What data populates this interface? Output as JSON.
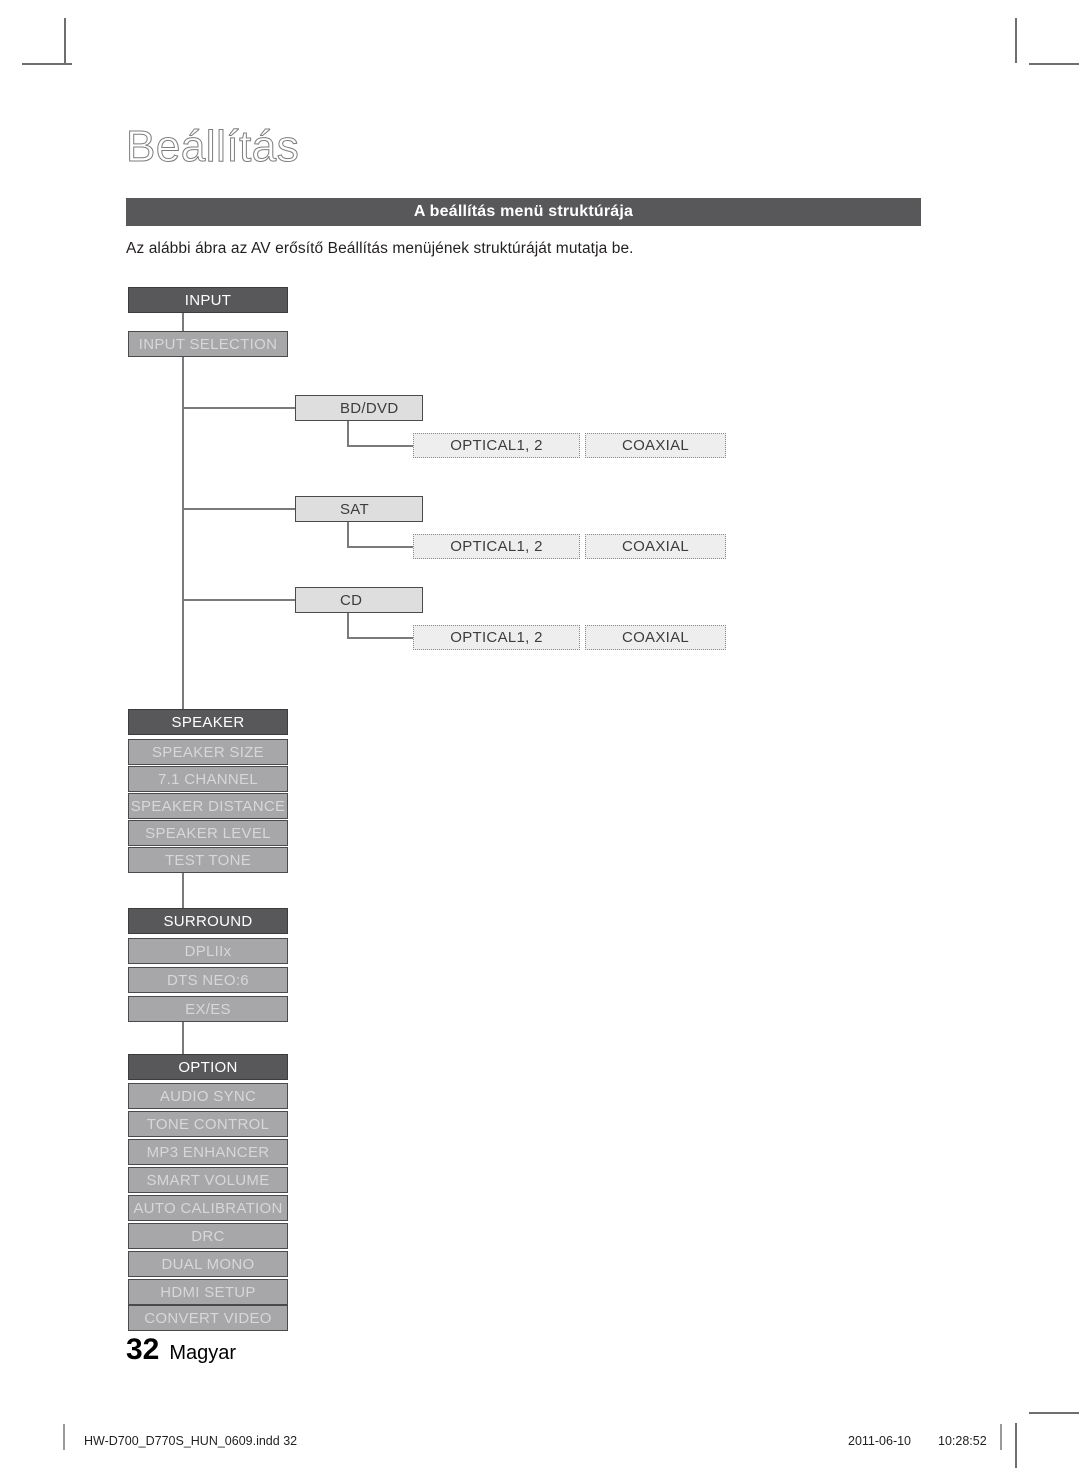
{
  "page": {
    "chapter_title": "Beállítás",
    "section_heading": "A beállítás menü struktúrája",
    "intro_text": "Az alábbi ábra az AV erősítő Beállítás menüjének struktúráját mutatja be.",
    "folio_number": "32",
    "folio_language": "Magyar",
    "imprint_file": "HW-D700_D770S_HUN_0609.indd   32",
    "imprint_date": "2011-06-10",
    "imprint_time": "10:28:52"
  },
  "colors": {
    "header_dark": "#58585b",
    "row_mid": "#a7a7a9",
    "box_light": "#dededf",
    "leaf_light": "#eeeeef",
    "line": "#7a7a7c",
    "text_dark": "#231f20"
  },
  "diagram": {
    "type": "menu-tree",
    "groups": [
      {
        "id": "input",
        "header": "INPUT",
        "rows": [
          "INPUT SELECTION"
        ],
        "sources": [
          {
            "label": "BD/DVD",
            "leaves": [
              "OPTICAL1, 2",
              "COAXIAL"
            ]
          },
          {
            "label": "SAT",
            "leaves": [
              "OPTICAL1, 2",
              "COAXIAL"
            ]
          },
          {
            "label": "CD",
            "leaves": [
              "OPTICAL1, 2",
              "COAXIAL"
            ]
          }
        ]
      },
      {
        "id": "speaker",
        "header": "SPEAKER",
        "rows": [
          "SPEAKER SIZE",
          "7.1 CHANNEL",
          "SPEAKER DISTANCE",
          "SPEAKER LEVEL",
          "TEST TONE"
        ],
        "sources": []
      },
      {
        "id": "surround",
        "header": "SURROUND",
        "rows": [
          "DPLIIx",
          "DTS NEO:6",
          "EX/ES"
        ],
        "sources": []
      },
      {
        "id": "option",
        "header": "OPTION",
        "rows": [
          "AUDIO SYNC",
          "TONE CONTROL",
          "MP3 ENHANCER",
          "SMART VOLUME",
          "AUTO CALIBRATION",
          "DRC",
          "DUAL MONO",
          "HDMI SETUP",
          "CONVERT VIDEO"
        ],
        "sources": []
      }
    ]
  }
}
